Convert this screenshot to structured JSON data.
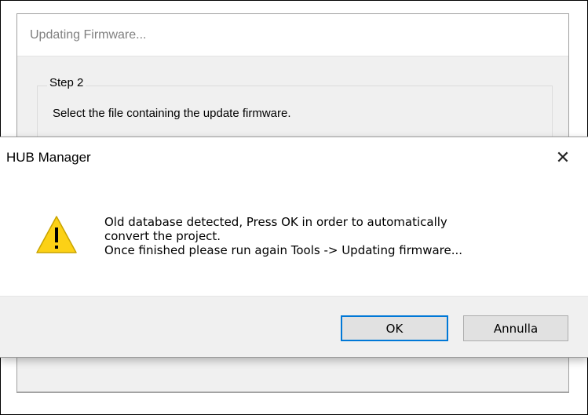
{
  "background_window": {
    "title": "Updating Firmware...",
    "step_label": "Step 2",
    "step_description": "Select the file containing the update firmware."
  },
  "dialog": {
    "title": "HUB Manager",
    "close_glyph": "✕",
    "icon": "warning-icon",
    "message": "Old database detected, Press OK in order to automatically\nconvert the project.\nOnce finished please run again Tools -> Updating firmware...",
    "ok_label": "OK",
    "cancel_label": "Annulla"
  },
  "colors": {
    "warning_fill": "#FCD116",
    "focus_border": "#0078d7"
  }
}
